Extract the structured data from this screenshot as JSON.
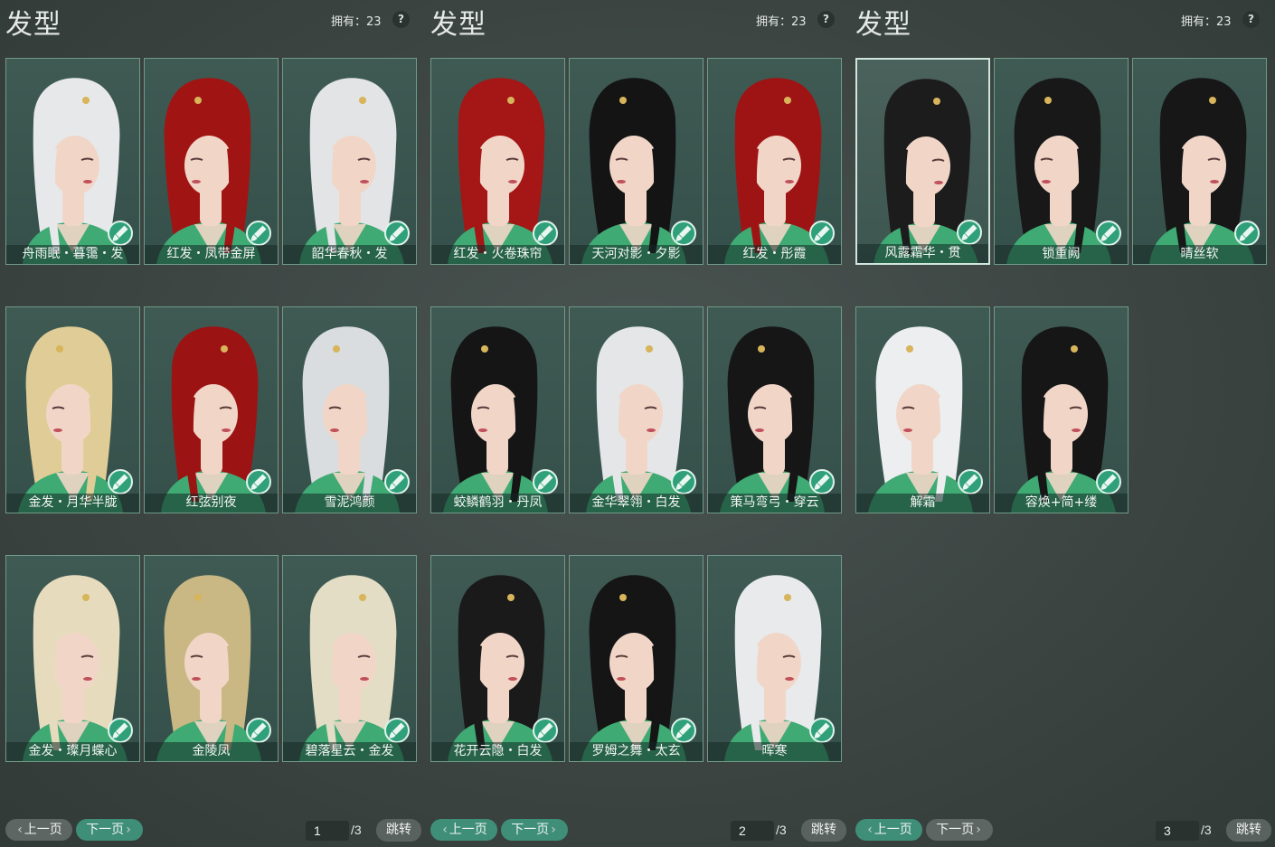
{
  "panels": [
    {
      "title": "发型",
      "owned": "拥有：23",
      "help": "?",
      "items": [
        {
          "label": "舟雨眠・暮霭・发",
          "hair": "#e6e8ea",
          "selected": false
        },
        {
          "label": "红发・凤带金屏",
          "hair": "#a11414",
          "selected": false
        },
        {
          "label": "韶华春秋・发",
          "hair": "#e2e4e6",
          "selected": false
        },
        {
          "label": "金发・月华半胧",
          "hair": "#e0cc96",
          "selected": false
        },
        {
          "label": "红弦别夜",
          "hair": "#9c1313",
          "selected": false
        },
        {
          "label": "雪泥鸿颜",
          "hair": "#d9dde0",
          "selected": false
        },
        {
          "label": "金发・璨月蝶心",
          "hair": "#e6dcbd",
          "selected": false
        },
        {
          "label": "金陵凤",
          "hair": "#c9b784",
          "selected": false
        },
        {
          "label": "碧落星云・金发",
          "hair": "#e3ddc6",
          "selected": false
        }
      ],
      "prev_label": "上一页",
      "next_label": "下一页",
      "prev_active": false,
      "next_active": true,
      "page": "1",
      "total": "/3",
      "jump_label": "跳转"
    },
    {
      "title": "发型",
      "owned": "拥有：23",
      "help": "?",
      "items": [
        {
          "label": "红发・火卷珠帘",
          "hair": "#a51616",
          "selected": false
        },
        {
          "label": "天河对影・夕影",
          "hair": "#141414",
          "selected": false
        },
        {
          "label": "红发・彤霞",
          "hair": "#9e1414",
          "selected": false
        },
        {
          "label": "蛟鳞鹤羽・丹凤",
          "hair": "#151515",
          "selected": false
        },
        {
          "label": "金华翠翎・白发",
          "hair": "#e4e6e8",
          "selected": false
        },
        {
          "label": "策马弯弓・穿云",
          "hair": "#161616",
          "selected": false
        },
        {
          "label": "花开云隐・白发",
          "hair": "#1a1a1a",
          "selected": false
        },
        {
          "label": "罗姆之舞・太玄",
          "hair": "#151515",
          "selected": false
        },
        {
          "label": "晖寒",
          "hair": "#e8eaec",
          "selected": false
        }
      ],
      "prev_label": "上一页",
      "next_label": "下一页",
      "prev_active": true,
      "next_active": true,
      "page": "2",
      "total": "/3",
      "jump_label": "跳转"
    },
    {
      "title": "发型",
      "owned": "拥有：23",
      "help": "?",
      "items": [
        {
          "label": "风露霜华・贯",
          "hair": "#1c1c1c",
          "selected": true
        },
        {
          "label": "锁重阙",
          "hair": "#181818",
          "selected": false
        },
        {
          "label": "晴丝软",
          "hair": "#171717",
          "selected": false
        },
        {
          "label": "解霜",
          "hair": "#eceef0",
          "selected": false
        },
        {
          "label": "容焕+简+缕",
          "hair": "#161616",
          "selected": false
        }
      ],
      "prev_label": "上一页",
      "next_label": "下一页",
      "prev_active": true,
      "next_active": false,
      "page": "3",
      "total": "/3",
      "jump_label": "跳转"
    }
  ],
  "icons": {
    "card_badge": "brush-icon",
    "help": "question-icon",
    "prev_arrow": "chevron-left-icon",
    "next_arrow": "chevron-right-icon"
  },
  "colors": {
    "card_border": "#6f9a88",
    "card_bg": "#3f5a53",
    "badge": "#2fa07a",
    "active_button": "#3f8f78",
    "dim_button": "#5e6663",
    "skin": "#f1d6c8",
    "outfit": "#3faa73"
  }
}
